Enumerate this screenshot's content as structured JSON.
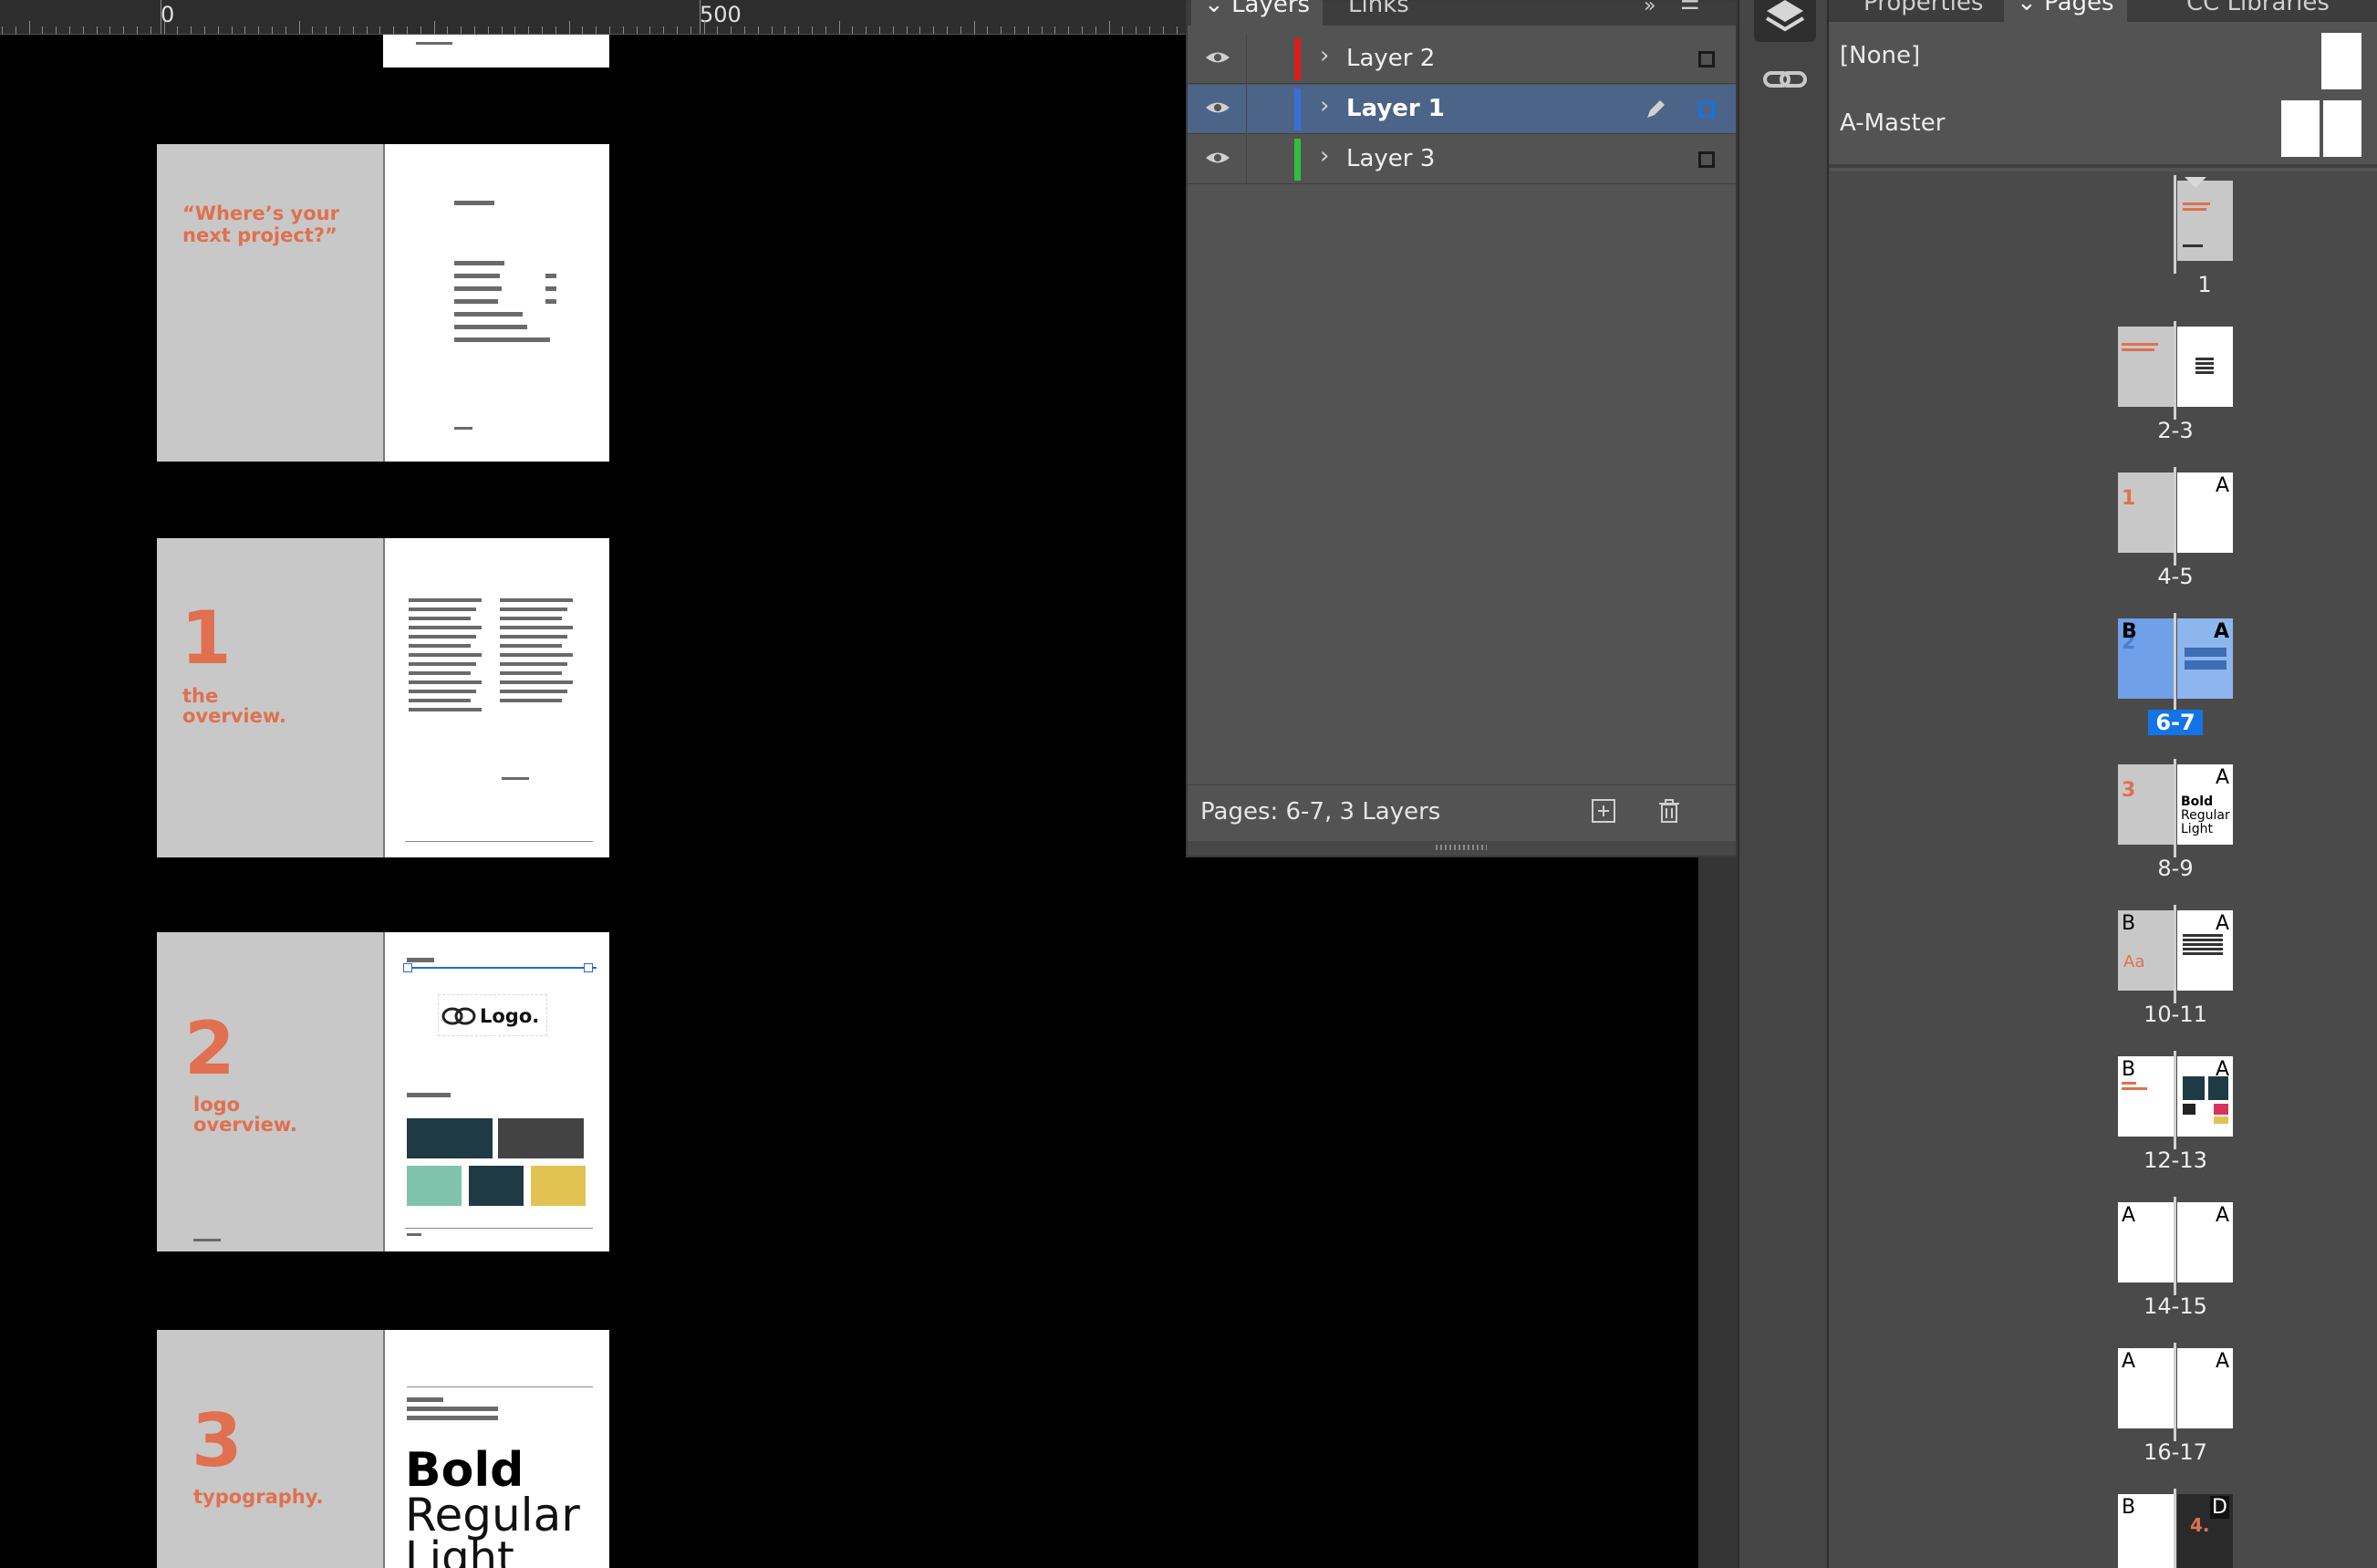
{
  "ruler": {
    "marks": [
      "0",
      "500"
    ]
  },
  "canvas": {
    "spread_2_3": {
      "quote": "“Where’s your next project?”"
    },
    "spread_4_5": {
      "number": "1",
      "title": "the overview."
    },
    "spread_6_7": {
      "number": "2",
      "title": "logo overview.",
      "logo_text": "Logo."
    },
    "spread_8_9": {
      "number": "3",
      "title": "typography.",
      "weights": [
        "Bold",
        "Regular",
        "Light"
      ]
    }
  },
  "layers_panel": {
    "tabs": [
      "Layers",
      "Links"
    ],
    "layers": [
      {
        "name": "Layer 2",
        "color": "#e01b1b",
        "selected": false
      },
      {
        "name": "Layer 1",
        "color": "#3a6fd8",
        "selected": true
      },
      {
        "name": "Layer 3",
        "color": "#2fc13a",
        "selected": false
      }
    ],
    "footer": "Pages: 6-7, 3 Layers"
  },
  "pages_panel": {
    "tabs": [
      "Properties",
      "Pages",
      "CC Libraries"
    ],
    "masters": [
      "[None]",
      "A-Master"
    ],
    "spreads": [
      {
        "label": "1",
        "masters": [
          "",
          ""
        ]
      },
      {
        "label": "2-3",
        "masters": [
          "",
          ""
        ]
      },
      {
        "label": "4-5",
        "masters": [
          "",
          "A"
        ]
      },
      {
        "label": "6-7",
        "masters": [
          "B",
          "A"
        ],
        "selected": true
      },
      {
        "label": "8-9",
        "masters": [
          "",
          "A"
        ]
      },
      {
        "label": "10-11",
        "masters": [
          "B",
          "A"
        ]
      },
      {
        "label": "12-13",
        "masters": [
          "B",
          "A"
        ]
      },
      {
        "label": "14-15",
        "masters": [
          "A",
          "A"
        ]
      },
      {
        "label": "16-17",
        "masters": [
          "A",
          "A"
        ]
      },
      {
        "label": "",
        "masters": [
          "B",
          "D"
        ]
      }
    ],
    "thumb_text": {
      "p2": "“Where’s your next project?”",
      "p4_num": "1",
      "p6_num": "2",
      "p8_num": "3",
      "p9_words": [
        "Bold",
        "Regular",
        "Light"
      ],
      "p10": "Aa",
      "p18_num": "4."
    }
  },
  "colors": {
    "accent": "#e0704f",
    "selection": "#1473e6",
    "panel": "#535353"
  }
}
